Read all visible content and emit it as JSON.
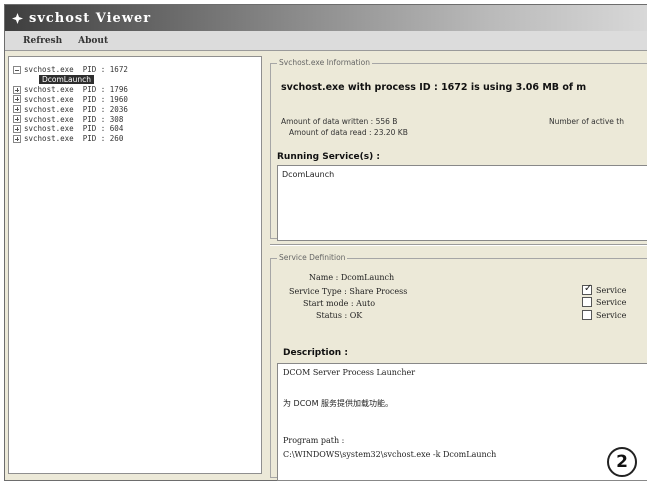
{
  "window": {
    "title": "svchost Viewer"
  },
  "menu": {
    "items": [
      "Refresh",
      "About"
    ]
  },
  "tree": {
    "rows": [
      {
        "label": "svchost.exe  PID : 1672",
        "expanded": true
      },
      {
        "label": "svchost.exe  PID : 1796",
        "expanded": false
      },
      {
        "label": "svchost.exe  PID : 1960",
        "expanded": false
      },
      {
        "label": "svchost.exe  PID : 2036",
        "expanded": false
      },
      {
        "label": "svchost.exe  PID : 308",
        "expanded": false
      },
      {
        "label": "svchost.exe  PID : 604",
        "expanded": false
      },
      {
        "label": "svchost.exe  PID : 260",
        "expanded": false
      }
    ],
    "selected_child": "DcomLaunch"
  },
  "info": {
    "caption": "Svchost.exe Information",
    "headline": "svchost.exe with process ID : 1672 is using 3.06 MB of m",
    "data_written": "Amount of data written : 556 B",
    "data_read": "Amount of data read : 23.20 KB",
    "active_threads": "Number of active th",
    "running_label": "Running Service(s) :",
    "running_services": [
      "DcomLaunch"
    ]
  },
  "definition": {
    "caption": "Service Definition",
    "name": "Name : DcomLaunch",
    "type": "Service Type : Share Process",
    "start_mode": "Start mode : Auto",
    "status": "Status : OK",
    "checkboxes": [
      {
        "label": "Service",
        "checked": true
      },
      {
        "label": "Service",
        "checked": false
      },
      {
        "label": "Service",
        "checked": false
      }
    ],
    "description_label": "Description :",
    "description_lines": [
      "DCOM Server Process Launcher",
      "为 DCOM 服务提供加载功能。",
      "Program path :",
      "C:\\WINDOWS\\system32\\svchost.exe -k DcomLaunch"
    ]
  },
  "badge": "2"
}
